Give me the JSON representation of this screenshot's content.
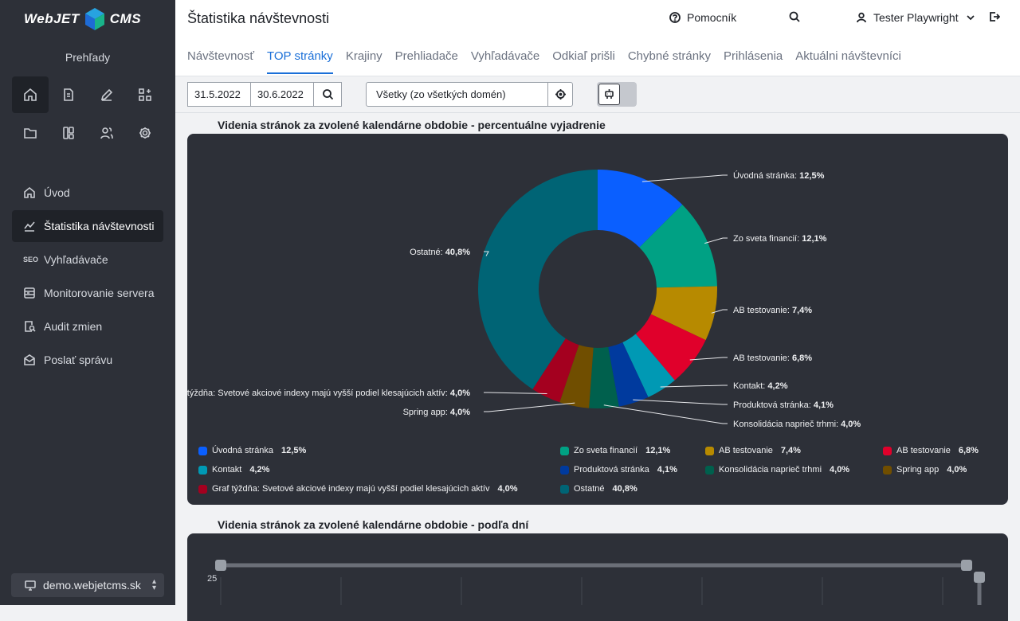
{
  "sidebar": {
    "logo_left": "WebJET",
    "logo_right": "CMS",
    "section_title": "Prehľady",
    "nav": [
      {
        "label": "Úvod"
      },
      {
        "label": "Štatistika návštevnosti"
      },
      {
        "label": "Vyhľadávače",
        "badge": "SEO"
      },
      {
        "label": "Monitorovanie servera"
      },
      {
        "label": "Audit zmien"
      },
      {
        "label": "Poslať správu"
      }
    ],
    "domain": "demo.webjetcms.sk"
  },
  "header": {
    "title": "Štatistika návštevnosti",
    "help": "Pomocník",
    "user": "Tester Playwright"
  },
  "tabs": [
    "Návštevnosť",
    "TOP stránky",
    "Krajiny",
    "Prehliadače",
    "Vyhľadávače",
    "Odkiaľ prišli",
    "Chybné stránky",
    "Prihlásenia",
    "Aktuálni návštevníci"
  ],
  "filters": {
    "date_from": "31.5.2022",
    "date_to": "30.6.2022",
    "domain_select": "Všetky (zo všetkých domén)"
  },
  "charts": {
    "pie_title": "Videnia stránok za zvolené kalendárne obdobie - percentuálne vyjadrenie",
    "line_title": "Videnia stránok za zvolené kalendárne obdobie - podľa dní",
    "line_y_tick": "25"
  },
  "colors": {
    "accent": "#1a6fd8",
    "sidebar": "#2d3038",
    "card": "#2d3038"
  },
  "chart_data": [
    {
      "type": "pie",
      "title": "Videnia stránok za zvolené kalendárne obdobie - percentuálne vyjadrenie",
      "slices": [
        {
          "label": "Úvodná stránka",
          "value": 12.5,
          "display": "12,5%",
          "color": "#0a5fff"
        },
        {
          "label": "Zo sveta financií",
          "value": 12.1,
          "display": "12,1%",
          "color": "#00a184"
        },
        {
          "label": "AB testovanie",
          "value": 7.4,
          "display": "7,4%",
          "color": "#b78a00"
        },
        {
          "label": "AB testovanie",
          "value": 6.8,
          "display": "6,8%",
          "color": "#e0002b"
        },
        {
          "label": "Kontakt",
          "value": 4.2,
          "display": "4,2%",
          "color": "#0099b4"
        },
        {
          "label": "Produktová stránka",
          "value": 4.1,
          "display": "4,1%",
          "color": "#003a9e"
        },
        {
          "label": "Konsolidácia naprieč trhmi",
          "value": 4.0,
          "display": "4,0%",
          "color": "#00604d"
        },
        {
          "label": "Spring app",
          "value": 4.0,
          "display": "4,0%",
          "color": "#704e00"
        },
        {
          "label": "Graf týždňa: Svetové akciové indexy majú vyšší podiel klesajúcich aktív",
          "value": 4.0,
          "display": "4,0%",
          "color": "#a4001f"
        },
        {
          "label": "Ostatné",
          "value": 40.8,
          "display": "40,8%",
          "color": "#006475"
        }
      ],
      "legend": "bottom"
    },
    {
      "type": "line",
      "title": "Videnia stránok za zvolené kalendárne obdobie - podľa dní",
      "y_ticks": [
        "25"
      ],
      "series": []
    }
  ]
}
